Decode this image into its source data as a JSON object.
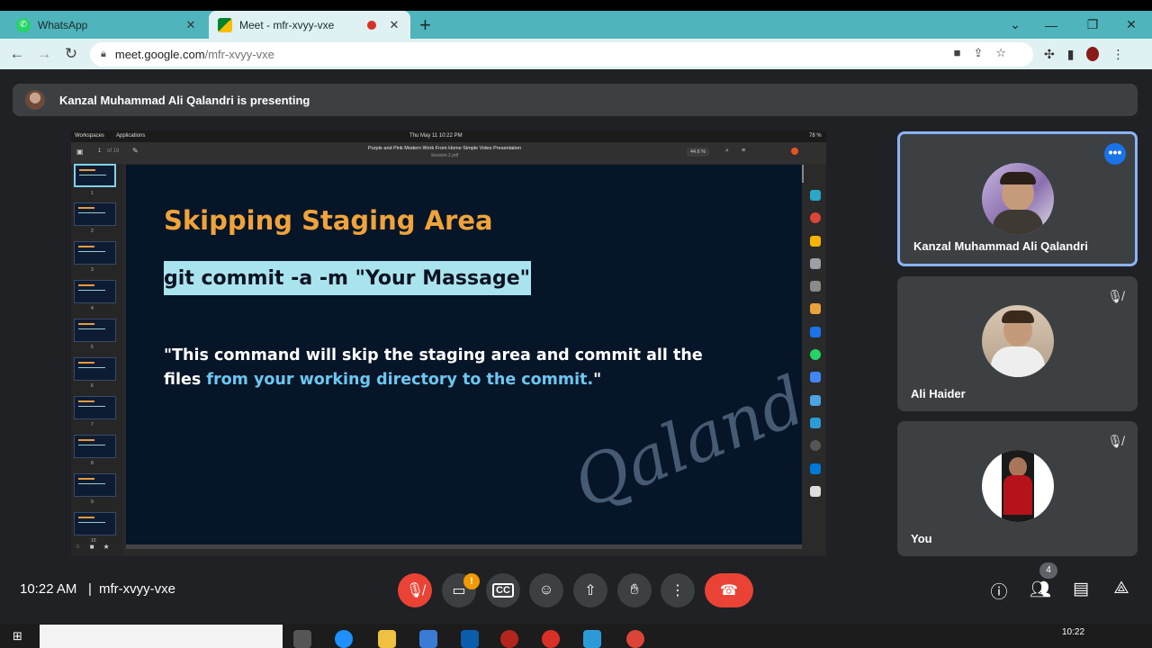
{
  "browser": {
    "tabs": [
      {
        "title": "WhatsApp",
        "active": false
      },
      {
        "title": "Meet - mfr-xvyy-vxe",
        "active": true,
        "recording": true
      }
    ],
    "url_host": "meet.google.com",
    "url_path": "/mfr-xvyy-vxe"
  },
  "banner": {
    "text": "Kanzal Muhammad Ali Qalandri is presenting"
  },
  "presentation": {
    "os_bar": {
      "workspaces": "Workspaces",
      "applications": "Applications",
      "datetime": "Thu May 11  10:22 PM",
      "battery": "78 %"
    },
    "viewer": {
      "page": "1",
      "page_total": "of 19",
      "doc_title": "Purple and Pink Modern Work From Home Simple Video Presentation",
      "doc_subtitle": "Session 2.pdf",
      "zoom": "44.6 %"
    },
    "slide": {
      "title": "Skipping Staging Area",
      "command": "git commit -a -m \"Your Massage\"",
      "desc_plain": "\"This command will skip the staging area and commit all the files ",
      "desc_highlight": "from your working directory to the commit.",
      "desc_end": "\"",
      "watermark": "Qalandri"
    },
    "thumb_numbers": [
      "1",
      "2",
      "3",
      "4",
      "5",
      "6",
      "7",
      "8",
      "9",
      "10"
    ]
  },
  "participants": [
    {
      "name": "Kanzal Muhammad Ali Qalandri",
      "speaking": true
    },
    {
      "name": "Ali Haider",
      "muted": true
    },
    {
      "name": "You",
      "muted": true
    }
  ],
  "bottom_bar": {
    "time": "10:22 AM",
    "separator": "|",
    "meeting_code": "mfr-xvyy-vxe",
    "camera_warning": "!",
    "participant_count": "4",
    "icons": [
      "mic-off-icon",
      "camera-off-icon",
      "captions-icon",
      "emoji-icon",
      "present-icon",
      "raise-hand-icon",
      "more-options-icon",
      "end-call-icon",
      "info-icon",
      "people-icon",
      "chat-icon",
      "activities-icon"
    ]
  },
  "taskbar": {
    "time": "10:22"
  },
  "colors": {
    "tab_bar": "#4fb4bb",
    "slide_bg": "#071528",
    "slide_title": "#efa33a",
    "command_bg": "#a9e4ee",
    "highlight_text": "#6cc7f0",
    "end_call": "#ea4335"
  }
}
